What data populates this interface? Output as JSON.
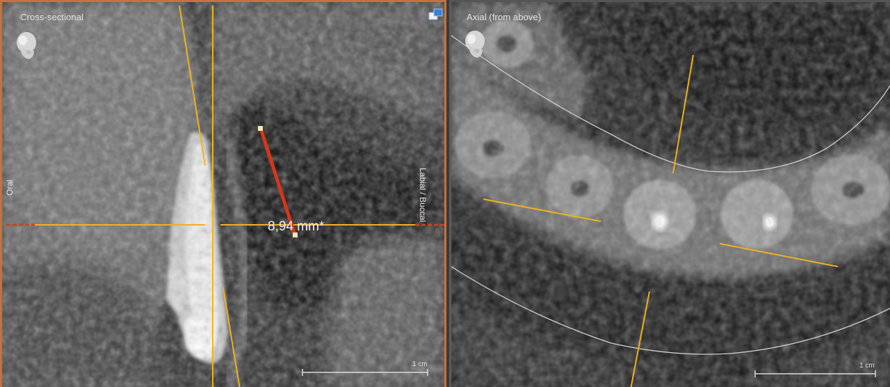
{
  "views": {
    "left": {
      "title": "Cross-sectional",
      "orientation_left": "Oral",
      "orientation_right": "Labial / Buccal",
      "measurement": "8,94 mm*",
      "scale_label": "1 cm"
    },
    "right": {
      "title": "Axial (from above)",
      "scale_label": "1 cm"
    }
  },
  "icons": {
    "orientation": "head-icon",
    "layout_toggle": "maximize-icon"
  },
  "colors": {
    "active_border": "#c9713a",
    "reference_line": "#f0b21d",
    "measurement_line": "#d8361c",
    "panel_curve": "#cfcfcf"
  }
}
